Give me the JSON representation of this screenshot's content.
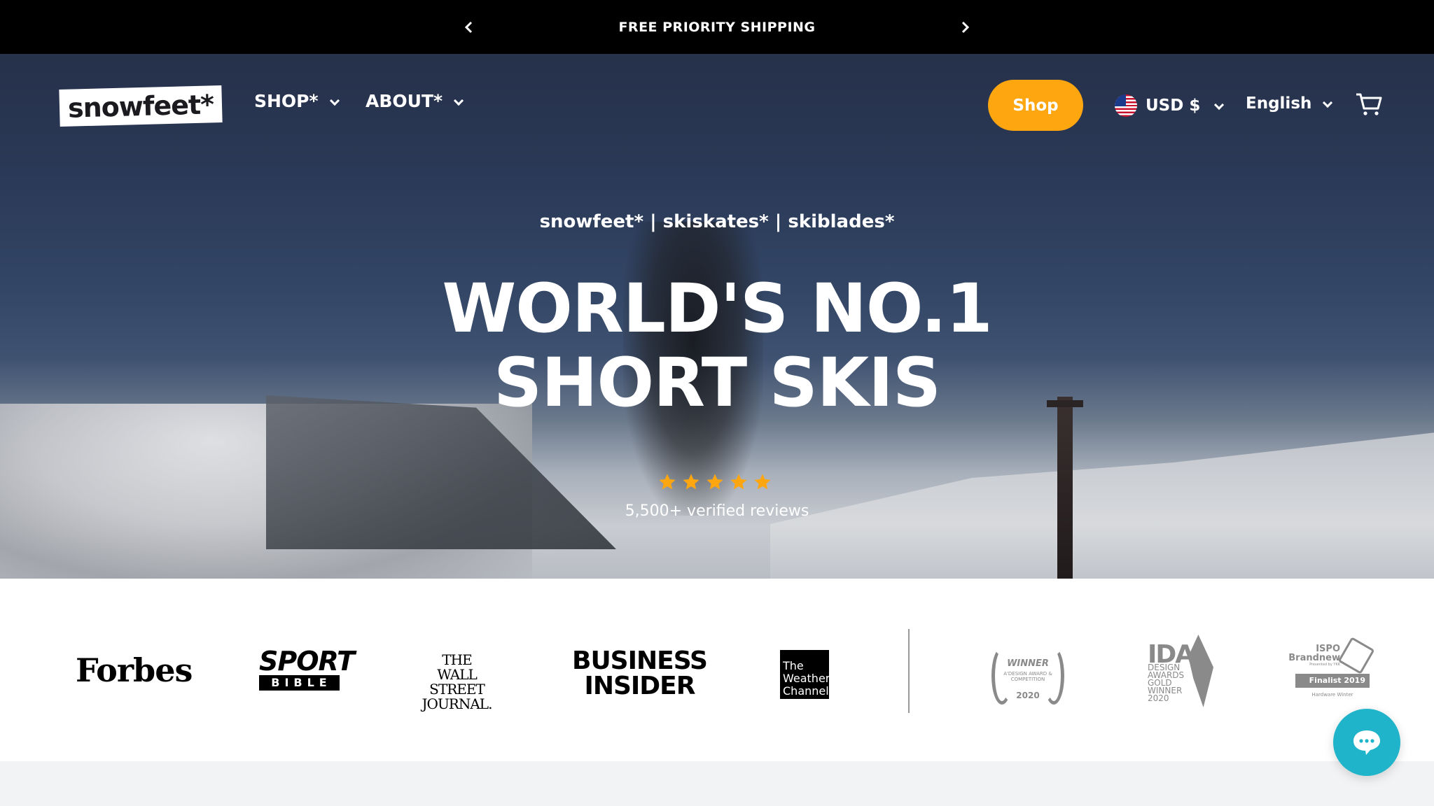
{
  "announcement": {
    "text": "FREE PRIORITY SHIPPING"
  },
  "header": {
    "logo_text": "snowfeet*",
    "nav": [
      {
        "label": "SHOP*"
      },
      {
        "label": "ABOUT*"
      }
    ],
    "shop_button": "Shop",
    "currency": "USD $",
    "language": "English"
  },
  "hero": {
    "tagline": "snowfeet* | skiskates* | skiblades*",
    "headline_line1": "WORLD'S NO.1",
    "headline_line2": "SHORT SKIS",
    "rating_stars": 5,
    "reviews": "5,500+ verified reviews"
  },
  "press": {
    "forbes": "Forbes",
    "sport_top": "SPORT",
    "sport_bottom": "BIBLE",
    "wsj_line1": "THE",
    "wsj_line2": "WALL STREET",
    "wsj_line3": "JOURNAL.",
    "bi_line1": "BUSINESS",
    "bi_line2": "INSIDER",
    "twc_line1": "The",
    "twc_line2": "Weather",
    "twc_line3": "Channel",
    "award_title": "WINNER",
    "award_sub": "A'DESIGN AWARD & COMPETITION",
    "award_year": "2020",
    "ida_big": "IDA",
    "ida_line1": "DESIGN",
    "ida_line2": "AWARDS",
    "ida_line3": "GOLD",
    "ida_line4": "WINNER",
    "ida_line5": "2020",
    "ispo_line1": "ISPO",
    "ispo_line2": "Brandnew",
    "ispo_presented": "Presented by YKK",
    "ispo_finalist": "Finalist 2019",
    "ispo_category": "Hardware Winter"
  },
  "colors": {
    "accent": "#fda610",
    "chat": "#1fb4c9",
    "announce_bg": "#000000",
    "star": "#fda610"
  },
  "icons": {
    "prev": "chevron-left-icon",
    "next": "chevron-right-icon",
    "cart": "cart-icon",
    "chat": "chat-bubble-icon",
    "flag": "us-flag-icon"
  }
}
